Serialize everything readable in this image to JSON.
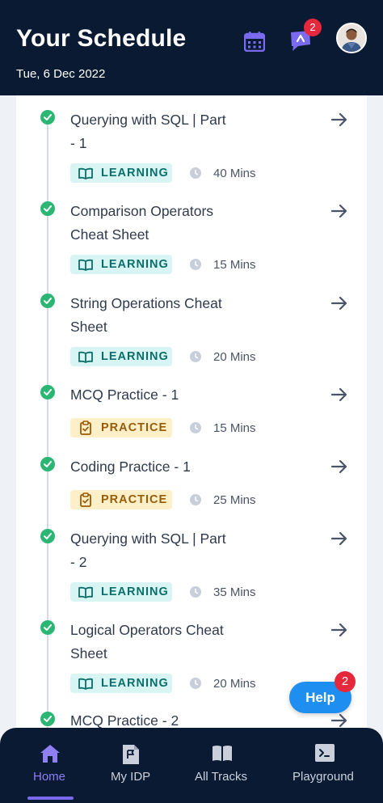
{
  "header": {
    "title": "Your Schedule",
    "date": "Tue, 6 Dec 2022",
    "notification_count": "2"
  },
  "schedule": [
    {
      "title_line1": "Querying with SQL | Part",
      "title_line2": "- 1",
      "tag": "LEARNING",
      "duration": "40 Mins"
    },
    {
      "title_line1": "Comparison Operators",
      "title_line2": "Cheat Sheet",
      "tag": "LEARNING",
      "duration": "15 Mins"
    },
    {
      "title_line1": "String Operations Cheat",
      "title_line2": "Sheet",
      "tag": "LEARNING",
      "duration": "20 Mins"
    },
    {
      "title_line1": "MCQ Practice - 1",
      "title_line2": "",
      "tag": "PRACTICE",
      "duration": "15 Mins"
    },
    {
      "title_line1": "Coding Practice - 1",
      "title_line2": "",
      "tag": "PRACTICE",
      "duration": "25 Mins"
    },
    {
      "title_line1": "Querying with SQL | Part",
      "title_line2": "- 2",
      "tag": "LEARNING",
      "duration": "35 Mins"
    },
    {
      "title_line1": "Logical Operators Cheat",
      "title_line2": "Sheet",
      "tag": "LEARNING",
      "duration": "20 Mins"
    },
    {
      "title_line1": "MCQ Practice - 2",
      "title_line2": "",
      "tag": "",
      "duration": ""
    }
  ],
  "help": {
    "label": "Help",
    "badge": "2"
  },
  "nav": {
    "items": [
      {
        "label": "Home",
        "icon": "home-icon",
        "active": true
      },
      {
        "label": "My IDP",
        "icon": "document-flag-icon"
      },
      {
        "label": "All Tracks",
        "icon": "book-icon"
      },
      {
        "label": "Playground",
        "icon": "terminal-icon"
      }
    ]
  },
  "colors": {
    "header_bg": "#0b1a33",
    "accent": "#7a6af0",
    "check": "#2bb673",
    "learning_bg": "#d8f5f3",
    "practice_bg": "#fdf0c9",
    "badge": "#e5283b",
    "help_bg": "#1e8ff0"
  }
}
